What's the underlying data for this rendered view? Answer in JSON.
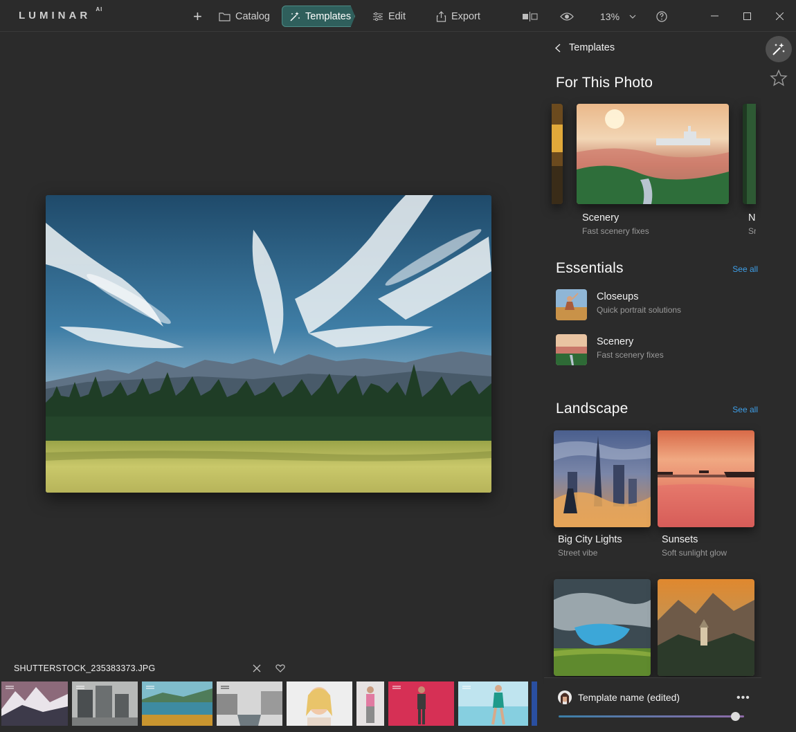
{
  "app": {
    "logo": "LUMINAR",
    "logo_suffix": "AI"
  },
  "toolbar": {
    "add_label": "+",
    "catalog_label": "Catalog",
    "templates_label": "Templates",
    "edit_label": "Edit",
    "export_label": "Export",
    "zoom_value": "13%"
  },
  "photo": {
    "filename": "SHUTTERSTOCK_235383373.JPG"
  },
  "filmstrip": {
    "thumbnails": [
      "mountain-lake",
      "city-buildings",
      "lake-autumn",
      "canal-street",
      "blonde-portrait",
      "woman-standing",
      "woman-pink-background",
      "woman-swimsuit-beach",
      "blue-partial"
    ]
  },
  "panel": {
    "back_label": "Templates",
    "for_this_photo": {
      "title": "For This Photo",
      "cards": [
        {
          "title": "Scenery",
          "subtitle": "Fast scenery fixes"
        },
        {
          "title": "N",
          "subtitle": "Sr"
        }
      ]
    },
    "essentials": {
      "title": "Essentials",
      "see_all": "See all",
      "items": [
        {
          "title": "Closeups",
          "subtitle": "Quick portrait solutions"
        },
        {
          "title": "Scenery",
          "subtitle": "Fast scenery fixes"
        }
      ]
    },
    "landscape": {
      "title": "Landscape",
      "see_all": "See all",
      "cards": [
        {
          "title": "Big City Lights",
          "subtitle": "Street vibe"
        },
        {
          "title": "Sunsets",
          "subtitle": "Soft sunlight glow"
        }
      ]
    },
    "template_card": {
      "name": "Template name (edited)",
      "more": "•••",
      "amount": 0.95
    }
  },
  "colors": {
    "accent_templates": "#2f5f5c",
    "see_all": "#3e9fe8",
    "background": "#2b2b2b"
  }
}
